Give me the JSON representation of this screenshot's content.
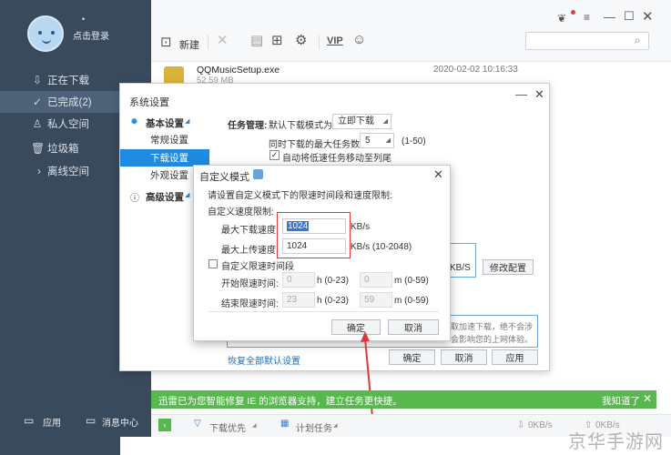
{
  "sidebar": {
    "login_text": "点击登录",
    "items": [
      {
        "label": "正在下载",
        "icon": "download-icon"
      },
      {
        "label": "已完成(2)",
        "icon": "check-circle-icon",
        "active": true
      },
      {
        "label": "私人空间",
        "icon": "user-icon"
      },
      {
        "label": "垃圾箱",
        "icon": "trash-icon"
      },
      {
        "label": "离线空间",
        "icon": "cloud-icon"
      }
    ],
    "footer": {
      "apps_label": "应用",
      "messages_label": "消息中心"
    }
  },
  "toolbar": {
    "new_label": "新建",
    "vip_label": "VIP"
  },
  "file": {
    "name": "QQMusicSetup.exe",
    "size": "52.59 MB",
    "time": "2020-02-02 10:16:33"
  },
  "settings": {
    "title": "系统设置",
    "nav": {
      "basic": "基本设置",
      "general": "常规设置",
      "download": "下载设置",
      "appearance": "外观设置",
      "advanced": "高级设置"
    },
    "task_mgmt_label": "任务管理:",
    "default_mode_label": "默认下载模式为",
    "default_mode_value": "立即下载",
    "max_tasks_label": "同时下载的最大任务数",
    "max_tasks_value": "5",
    "max_tasks_range": "(1-50)",
    "auto_move_label": "自动将低速任务移动至列尾",
    "speed_display": "KB/S",
    "modify_config": "修改配置",
    "hint_line1": "取加速下载，绝不会涉",
    "hint_line2": "会影响您的上网体验。",
    "restore_link": "恢复全部默认设置",
    "ok": "确定",
    "cancel": "取消",
    "apply": "应用"
  },
  "dialog": {
    "title": "自定义模式",
    "intro": "请设置自定义模式下的限速时间段和速度限制:",
    "speed_section": "自定义速度限制:",
    "max_download_label": "最大下载速度:",
    "max_download_value": "1024",
    "max_upload_label": "最大上传速度:",
    "max_upload_value": "1024",
    "unit": "KB/s",
    "upload_range": "KB/s (10-2048)",
    "time_section": "自定义限速时间段",
    "start_label": "开始限速时间:",
    "end_label": "结束限速时间:",
    "start_h": "0",
    "start_m": "0",
    "end_h": "23",
    "end_m": "59",
    "h_range": "h (0-23)",
    "m_range": "m (0-59)",
    "ok": "确定",
    "cancel": "取消"
  },
  "notify": {
    "text": "迅雷已为您智能修复 IE 的浏览器支持，建立任务更快捷。",
    "dismiss": "我知道了"
  },
  "status": {
    "priority": "下载优先",
    "plan": "计划任务",
    "down_speed": "0KB/s",
    "up_speed": "0KB/s"
  },
  "watermark": "京华手游网"
}
